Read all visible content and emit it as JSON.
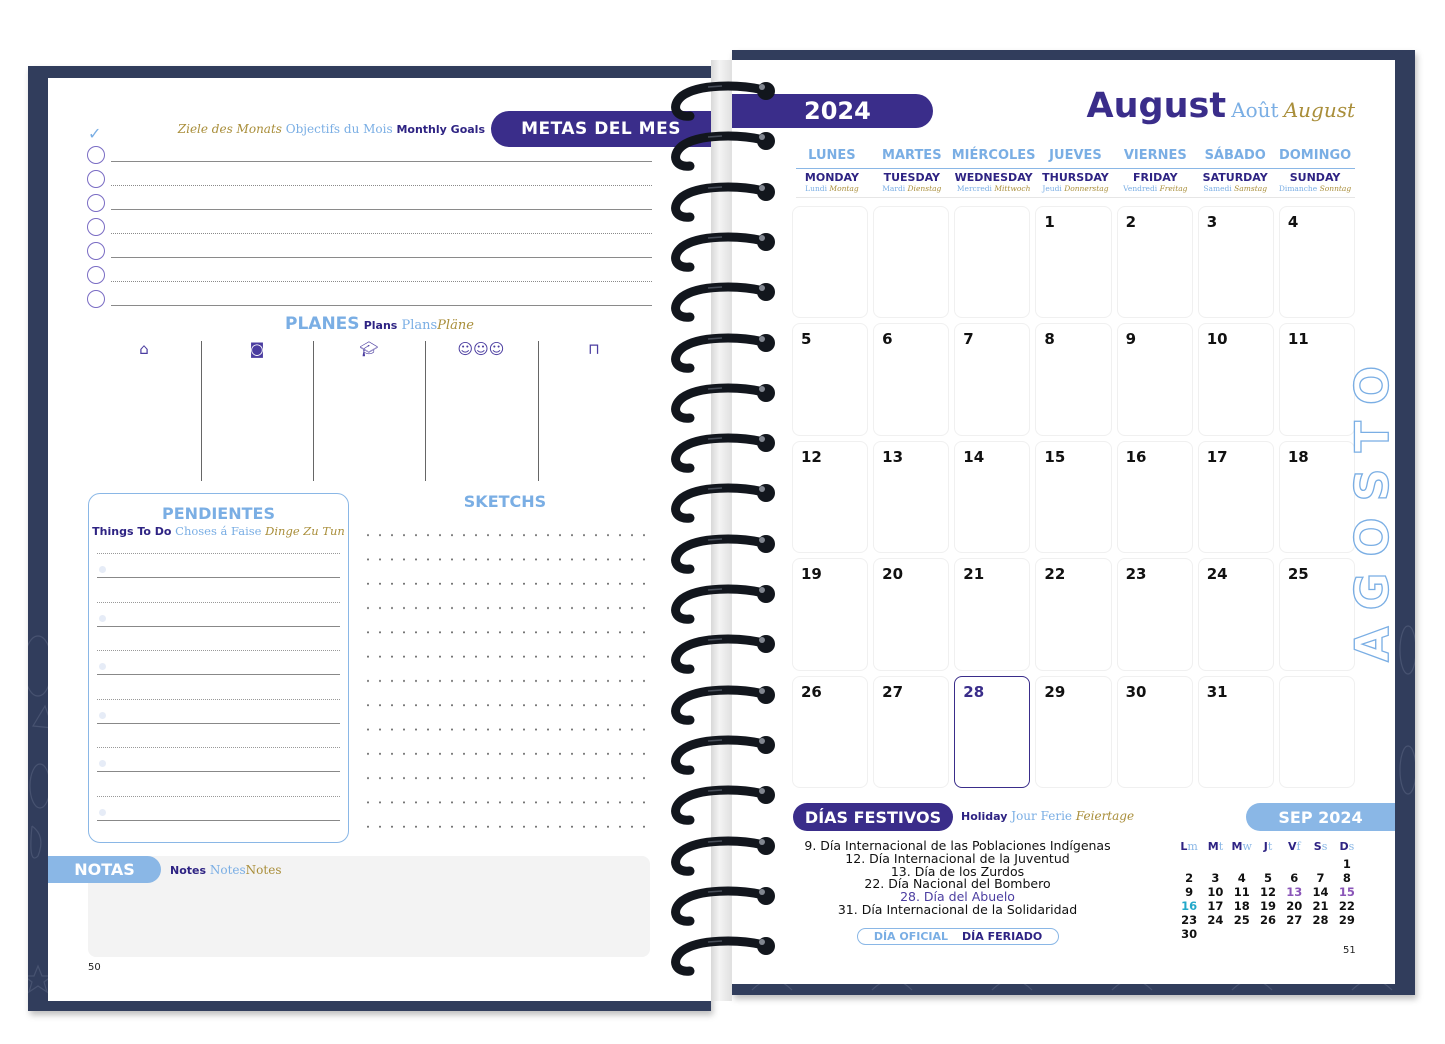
{
  "left_page": {
    "monthly_goals": {
      "title": "METAS DEL MES",
      "subtitle_de": "Ziele des Monats",
      "subtitle_fr": "Objectifs du Mois",
      "subtitle_en": "Monthly Goals",
      "check_icon": "checkmark-icon",
      "rows": [
        {
          "style": "solid"
        },
        {
          "style": "dotted"
        },
        {
          "style": "solid"
        },
        {
          "style": "dotted"
        },
        {
          "style": "solid"
        },
        {
          "style": "dotted"
        },
        {
          "style": "solid"
        }
      ]
    },
    "plans": {
      "title_es": "PLANES",
      "title_en": "Plans",
      "title_fr": "Plans",
      "title_de": "Pläne",
      "columns": [
        {
          "icon": "home-icon",
          "glyph": "⌂"
        },
        {
          "icon": "globe-book-icon",
          "glyph": "◙"
        },
        {
          "icon": "graduation-cap-icon",
          "glyph": "🎓︎"
        },
        {
          "icon": "people-group-icon",
          "glyph": "☺☺☺"
        },
        {
          "icon": "desk-icon",
          "glyph": "⊓"
        }
      ]
    },
    "pending": {
      "title": "PENDIENTES",
      "sub_en": "Things To Do",
      "sub_fr": "Choses á Faise",
      "sub_de": "Dinge Zu Tun"
    },
    "sketch": {
      "title": "SKETCHS"
    },
    "notes": {
      "title": "NOTAS",
      "sub_en": "Notes",
      "sub_fr": "Notes",
      "sub_de": "Notes"
    },
    "page_number": "50"
  },
  "right_page": {
    "year": "2024",
    "month_es": "August",
    "month_fr": "Août",
    "month_de": "August",
    "side_label": "AGOSTO",
    "weekdays": [
      {
        "es": "LUNES",
        "en": "MONDAY",
        "fr": "Lundi",
        "de": "Montag"
      },
      {
        "es": "MARTES",
        "en": "TUESDAY",
        "fr": "Mardi",
        "de": "Dienstag"
      },
      {
        "es": "MIÉRCOLES",
        "en": "WEDNESDAY",
        "fr": "Mercredi",
        "de": "Mittwoch"
      },
      {
        "es": "JUEVES",
        "en": "THURSDAY",
        "fr": "Jeudi",
        "de": "Donnerstag"
      },
      {
        "es": "VIERNES",
        "en": "FRIDAY",
        "fr": "Vendredi",
        "de": "Freitag"
      },
      {
        "es": "SÁBADO",
        "en": "SATURDAY",
        "fr": "Samedi",
        "de": "Samstag"
      },
      {
        "es": "DOMINGO",
        "en": "SUNDAY",
        "fr": "Dimanche",
        "de": "Sonntag"
      }
    ],
    "days": [
      "",
      "",
      "",
      "1",
      "2",
      "3",
      "4",
      "5",
      "6",
      "7",
      "8",
      "9",
      "10",
      "11",
      "12",
      "13",
      "14",
      "15",
      "16",
      "17",
      "18",
      "19",
      "20",
      "21",
      "22",
      "23",
      "24",
      "25",
      "26",
      "27",
      "28",
      "29",
      "30",
      "31",
      ""
    ],
    "highlighted_day": "28",
    "holidays": {
      "title": "DÍAS FESTIVOS",
      "sub_en": "Holiday",
      "sub_fr": "Jour Ferie",
      "sub_de": "Feiertage",
      "items": [
        {
          "text": "9. Día Internacional de las Poblaciones Indígenas",
          "highlight": false
        },
        {
          "text": "12. Día Internacional de la Juventud",
          "highlight": false
        },
        {
          "text": "13. Día de los Zurdos",
          "highlight": false
        },
        {
          "text": "22. Día Nacional del Bombero",
          "highlight": false
        },
        {
          "text": "28. Día del Abuelo",
          "highlight": true
        },
        {
          "text": "31. Día Internacional de la Solidaridad",
          "highlight": false
        }
      ],
      "legend_official": "DÍA OFICIAL",
      "legend_holiday": "DÍA FERIADO"
    },
    "next_month": {
      "title": "SEP 2024",
      "headers": [
        {
          "a": "L",
          "b": "m"
        },
        {
          "a": "M",
          "b": "t"
        },
        {
          "a": "M",
          "b": "w"
        },
        {
          "a": "J",
          "b": "t"
        },
        {
          "a": "V",
          "b": "f"
        },
        {
          "a": "S",
          "b": "s"
        },
        {
          "a": "D",
          "b": "s"
        }
      ],
      "days": [
        "",
        "",
        "",
        "",
        "",
        "",
        "1",
        "2",
        "3",
        "4",
        "5",
        "6",
        "7",
        "8",
        "9",
        "10",
        "11",
        "12",
        "13",
        "14",
        "15",
        "16",
        "17",
        "18",
        "19",
        "20",
        "21",
        "22",
        "23",
        "24",
        "25",
        "26",
        "27",
        "28",
        "29",
        "30",
        "",
        "",
        "",
        "",
        "",
        ""
      ],
      "purple_days": [
        "13",
        "15"
      ],
      "cyan_days": [
        "16"
      ]
    },
    "page_number": "51"
  },
  "colors": {
    "navy": "#3a2d8a",
    "light_blue": "#8ab7e6",
    "gold": "#a98e3a",
    "cover": "#313d5c"
  }
}
